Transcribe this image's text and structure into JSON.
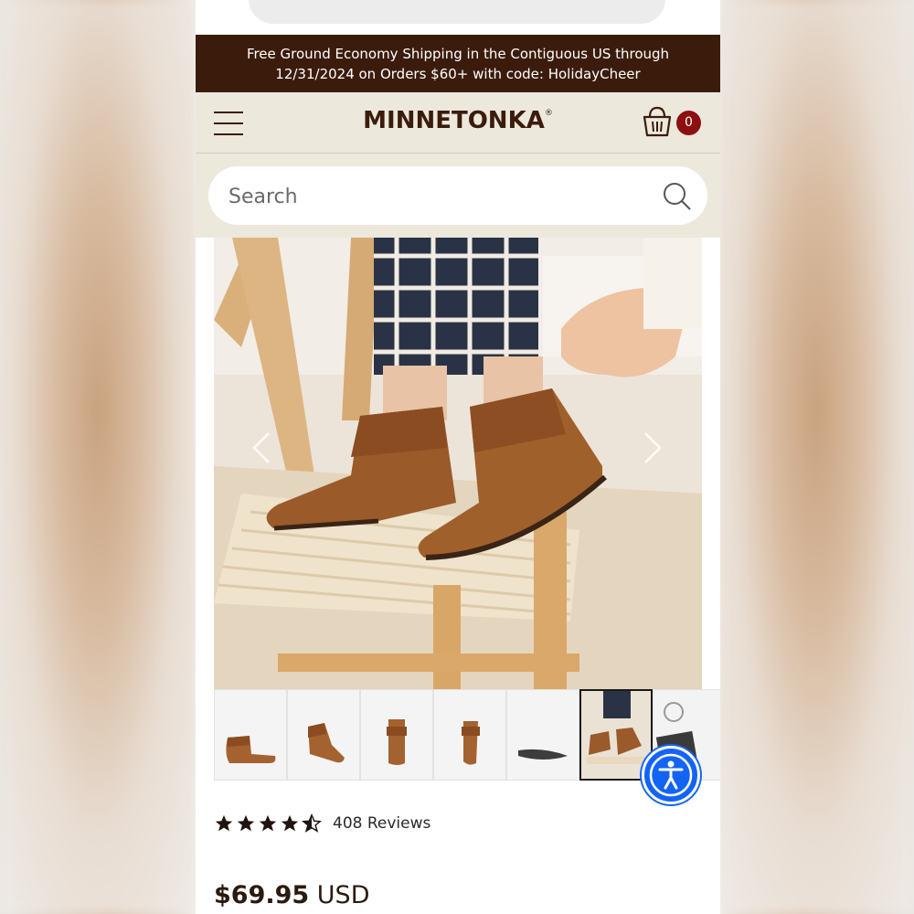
{
  "promo": {
    "line1": "Free Ground Economy Shipping in the Contiguous US through",
    "line2": "12/31/2024 on Orders $60+ with code: HolidayCheer"
  },
  "header": {
    "logo": "MINNETONKA",
    "logo_mark": "®",
    "cart_count": "0"
  },
  "search": {
    "placeholder": "Search"
  },
  "product": {
    "review_count": "408 Reviews",
    "rating": 4.5,
    "price_amount": "$69.95",
    "price_currency": "USD"
  },
  "gallery": {
    "thumbnail_count": 7,
    "active_index": 5
  },
  "colors": {
    "promo_bg": "#3b1c0c",
    "header_bg": "#ece8dc",
    "badge": "#8c1010",
    "accessibility": "#1464f4",
    "boot": "#9a5a2a"
  }
}
